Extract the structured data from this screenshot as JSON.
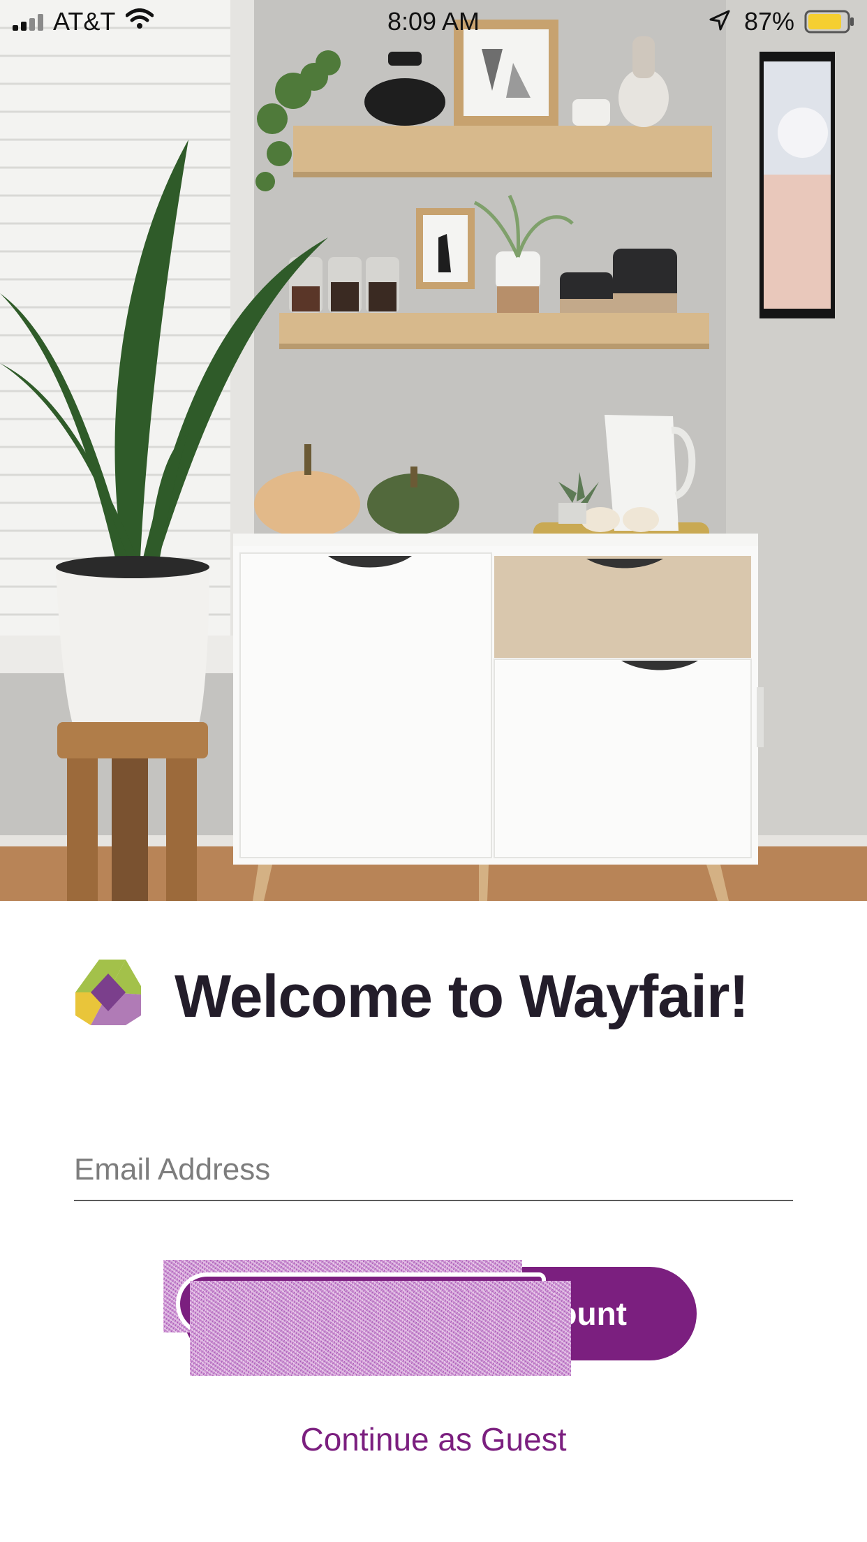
{
  "status_bar": {
    "carrier": "AT&T",
    "time": "8:09 AM",
    "battery_percent": "87%",
    "icons": [
      "cellular-signal-icon",
      "wifi-icon",
      "location-arrow-icon",
      "battery-icon"
    ]
  },
  "hero": {
    "image": "hero-room-photo"
  },
  "welcome": {
    "title": "Welcome to Wayfair!",
    "logo": "wayfair-logo-icon"
  },
  "email": {
    "placeholder": "Email Address",
    "value": ""
  },
  "cta": {
    "visible_label_fragment": "ount"
  },
  "guest": {
    "label": "Continue as Guest"
  },
  "colors": {
    "brand_purple": "#7b1f7f",
    "title_text": "#231d2a",
    "logo_green": "#a3c14a",
    "logo_yellow": "#e9c53a",
    "logo_purple": "#7b3f8c",
    "logo_lavender": "#b07bb6",
    "battery_fill": "#f5cf31"
  }
}
